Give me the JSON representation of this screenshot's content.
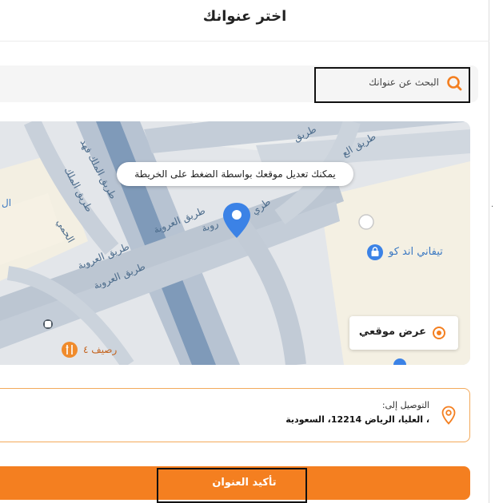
{
  "header": {
    "title": "اختر عنوانك"
  },
  "search": {
    "placeholder": "البحث عن عنوانك",
    "icon": "search-icon"
  },
  "map": {
    "tooltip": "يمكنك تعديل موقعك بواسطة الضغط على الخريطة",
    "road_labels": [
      "طريق الملك فهد",
      "طريق العروبة",
      "طريق العروبة",
      "طريق العروبة",
      "طريق الع",
      "طريق",
      "طريق الملك",
      "الحمي",
      "روبة",
      "طري"
    ],
    "poi": [
      {
        "name": "تيفاني اند كو",
        "icon": "shopping-bag-icon"
      },
      {
        "name": "رصيف ٤",
        "icon": "restaurant-icon"
      }
    ],
    "edge_text": "ال",
    "my_location_label": "عرض موقعي"
  },
  "delivery": {
    "heading": "التوصيل إلى:",
    "address": "، العليا، الرياض 12214، السعودية"
  },
  "confirm_button": {
    "label": "تأكيد العنوان"
  },
  "colors": {
    "accent": "#f47f20",
    "map_road": "#b9c4d0",
    "highway": "#7a95b6",
    "pin": "#3b82e6"
  }
}
